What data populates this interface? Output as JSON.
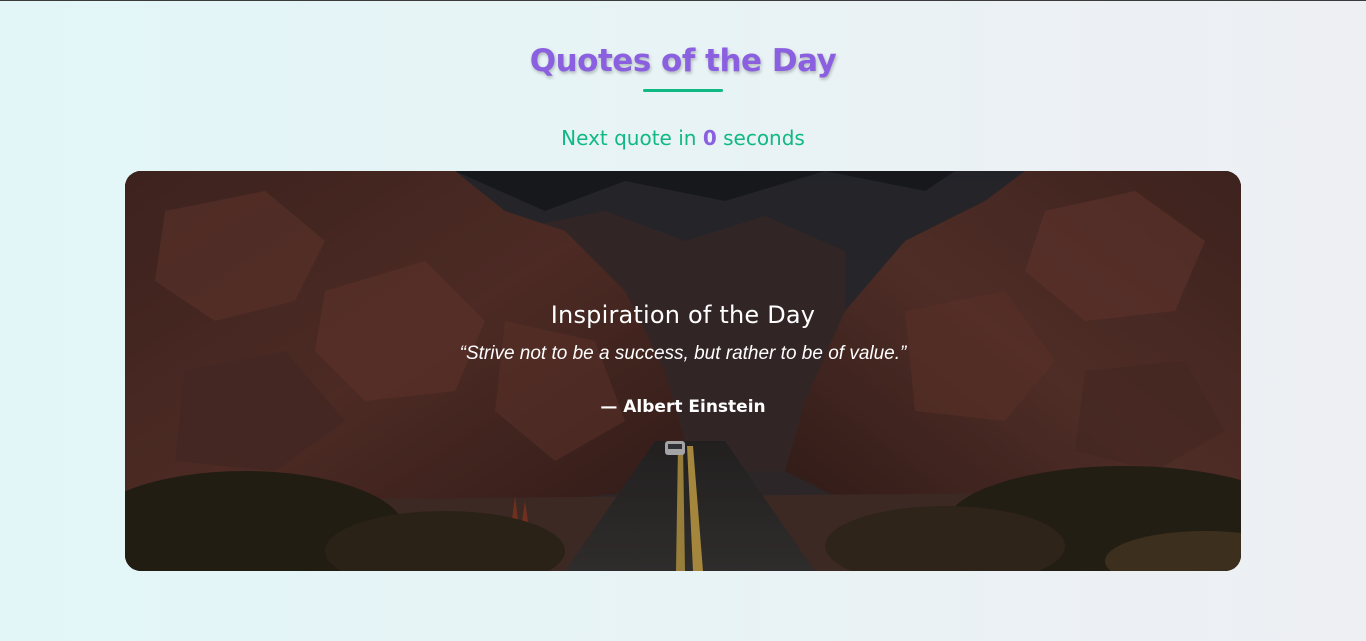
{
  "header": {
    "title": "Quotes of the Day",
    "accent_color": "#8a5fe0",
    "underline_color": "#10b981"
  },
  "countdown": {
    "prefix": "Next quote in",
    "value": "0",
    "suffix": "seconds"
  },
  "quote_card": {
    "heading": "Inspiration of the Day",
    "quote": "“Strive not to be a success, but rather to be of value.”",
    "author": "— Albert Einstein",
    "background_image": "desert canyon road"
  }
}
